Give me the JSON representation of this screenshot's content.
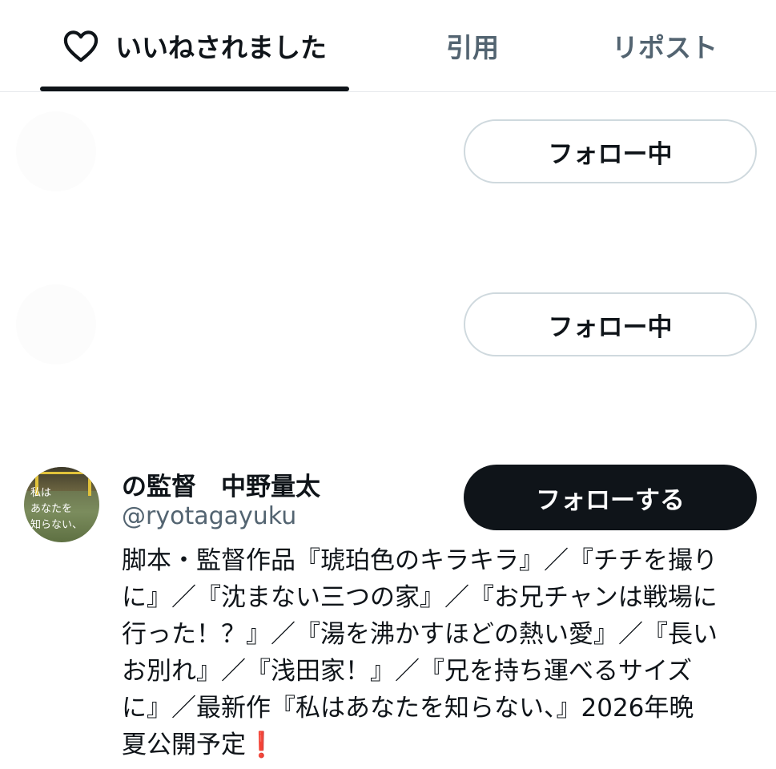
{
  "tabs": [
    {
      "label": "いいねされました",
      "icon": "heart-icon",
      "active": true
    },
    {
      "label": "引用",
      "active": false
    },
    {
      "label": "リポスト",
      "active": false
    }
  ],
  "users": [
    {
      "button_label": "フォロー中"
    },
    {
      "button_label": "フォロー中"
    }
  ],
  "profile": {
    "display_name": "の監督　中野量太",
    "handle": "@ryotagayuku",
    "follow_button": "フォローする",
    "avatar_text": [
      "私は",
      "あなたを",
      "知らない、"
    ],
    "bio_lines": [
      "脚本・監督作品『琥珀色のキラキラ』／『チチを撮り",
      "に』／『沈まない三つの家』／『お兄チャンは戦場に",
      "行った！？』／『湯を沸かすほどの熱い愛』／『長い",
      "お別れ』／『浅田家！』／『兄を持ち運べるサイズ",
      "に』／最新作『私はあなたを知らない、』2026年晩",
      "夏公開予定"
    ],
    "bio_emoji": "❗"
  },
  "colors": {
    "text_primary": "#0f1419",
    "text_secondary": "#536471",
    "border": "#cfd9de",
    "accent_exclaim": "#e0252a"
  }
}
